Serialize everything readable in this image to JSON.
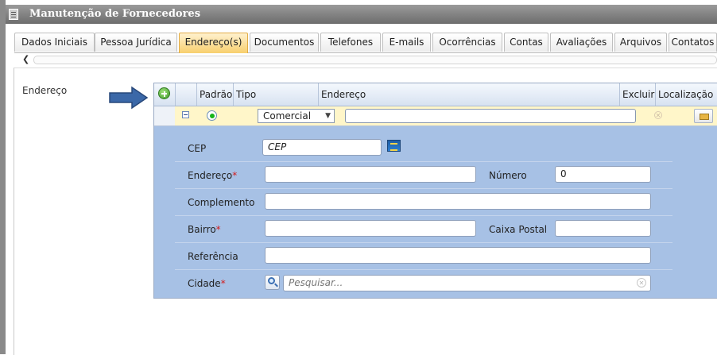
{
  "window": {
    "title": "Manutenção de Fornecedores"
  },
  "tabs": [
    {
      "label": "Dados Iniciais"
    },
    {
      "label": "Pessoa Jurídica"
    },
    {
      "label": "Endereço(s)",
      "active": true
    },
    {
      "label": "Documentos"
    },
    {
      "label": "Telefones"
    },
    {
      "label": "E-mails"
    },
    {
      "label": "Ocorrências"
    },
    {
      "label": "Contas"
    },
    {
      "label": "Avaliações"
    },
    {
      "label": "Arquivos"
    },
    {
      "label": "Contatos"
    }
  ],
  "section": {
    "label": "Endereço"
  },
  "grid": {
    "columns": {
      "padrao": "Padrão",
      "tipo": "Tipo",
      "endereco": "Endereço",
      "excluir": "Excluir",
      "localizacao": "Localização"
    },
    "row": {
      "tipo_value": "Comercial",
      "endereco_value": ""
    }
  },
  "form": {
    "cep": {
      "label": "CEP",
      "value": "CEP"
    },
    "endereco": {
      "label": "Endereço",
      "required": "*",
      "value": ""
    },
    "numero": {
      "label": "Número",
      "value": "0"
    },
    "complemento": {
      "label": "Complemento",
      "value": ""
    },
    "bairro": {
      "label": "Bairro",
      "required": "*",
      "value": ""
    },
    "caixa_postal": {
      "label": "Caixa Postal",
      "value": ""
    },
    "referencia": {
      "label": "Referência",
      "value": ""
    },
    "cidade": {
      "label": "Cidade",
      "required": "*",
      "placeholder": "Pesquisar..."
    }
  },
  "icons": {
    "window": "document-icon",
    "add": "add-circle-icon",
    "pointer": "arrow-right-icon",
    "collapse": "minus-box-icon",
    "delete": "close-circle-icon",
    "location": "map-icon",
    "correios": "correios-icon",
    "search": "search-icon",
    "clear": "clear-icon"
  },
  "colors": {
    "active_tab": "#f8cf6d",
    "grid_bg": "#a7c1e5",
    "required": "#d41c1c",
    "selected_row": "#fff6c9"
  }
}
